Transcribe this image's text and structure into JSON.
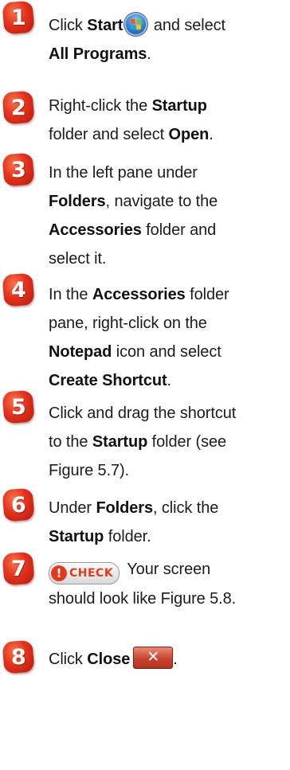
{
  "steps": [
    {
      "number": "1",
      "parts": [
        {
          "t": "Click "
        },
        {
          "t": "Start",
          "b": true
        },
        {
          "icon": "windows-start-orb-icon"
        },
        {
          "t": " and select"
        },
        {
          "br": true
        },
        {
          "t": "All Programs",
          "b": true
        },
        {
          "t": "."
        }
      ]
    },
    {
      "number": "2",
      "parts": [
        {
          "t": "Right-click the "
        },
        {
          "t": "Startup",
          "b": true
        },
        {
          "br": true
        },
        {
          "t": "folder and select "
        },
        {
          "t": "Open",
          "b": true
        },
        {
          "t": "."
        }
      ]
    },
    {
      "number": "3",
      "parts": [
        {
          "t": "In the left pane under"
        },
        {
          "br": true
        },
        {
          "t": "Folders",
          "b": true
        },
        {
          "t": ", navigate to the"
        },
        {
          "br": true
        },
        {
          "t": "Accessories",
          "b": true
        },
        {
          "t": " folder and"
        },
        {
          "br": true
        },
        {
          "t": "select it."
        }
      ]
    },
    {
      "number": "4",
      "parts": [
        {
          "t": "In the "
        },
        {
          "t": "Accessories",
          "b": true
        },
        {
          "t": " folder"
        },
        {
          "br": true
        },
        {
          "t": "pane, right-click on the"
        },
        {
          "br": true
        },
        {
          "t": "Notepad",
          "b": true
        },
        {
          "t": " icon and select"
        },
        {
          "br": true
        },
        {
          "t": "Create Shortcut",
          "b": true
        },
        {
          "t": "."
        }
      ]
    },
    {
      "number": "5",
      "parts": [
        {
          "t": "Click and drag the shortcut"
        },
        {
          "br": true
        },
        {
          "t": "to the "
        },
        {
          "t": "Startup",
          "b": true
        },
        {
          "t": " folder (see"
        },
        {
          "br": true
        },
        {
          "t": "Figure 5.7)."
        }
      ]
    },
    {
      "number": "6",
      "parts": [
        {
          "t": "Under "
        },
        {
          "t": "Folders",
          "b": true
        },
        {
          "t": ", click the"
        },
        {
          "br": true
        },
        {
          "t": "Startup",
          "b": true
        },
        {
          "t": " folder."
        }
      ]
    },
    {
      "number": "7",
      "parts": [
        {
          "icon": "check-badge-icon",
          "label": "CHECK"
        },
        {
          "t": " Your screen"
        },
        {
          "br": true
        },
        {
          "t": "should look like Figure 5.8."
        }
      ]
    },
    {
      "number": "8",
      "parts": [
        {
          "t": "Click "
        },
        {
          "t": "Close",
          "b": true
        },
        {
          "icon": "close-button-icon"
        },
        {
          "t": "."
        }
      ]
    }
  ],
  "colors": {
    "badge": "#e3321d",
    "text": "#1c1c1c"
  }
}
